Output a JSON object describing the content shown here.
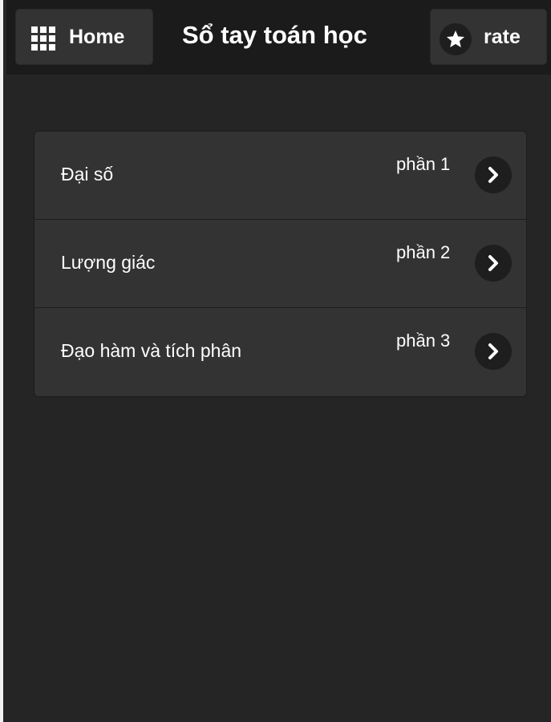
{
  "header": {
    "home_label": "Home",
    "title": "Sổ tay toán học",
    "rate_label": "rate",
    "home_icon": "grid-icon",
    "rate_icon": "star-icon"
  },
  "list": {
    "items": [
      {
        "label": "Đại số",
        "count": "phần 1",
        "icon": "chevron-right-icon"
      },
      {
        "label": "Lượng giác",
        "count": "phần 2",
        "icon": "chevron-right-icon"
      },
      {
        "label": "Đạo hàm và tích phân",
        "count": "phần 3",
        "icon": "chevron-right-icon"
      }
    ]
  },
  "colors": {
    "background": "#252525",
    "header_bg": "#1b1b1b",
    "button_bg": "#333333",
    "text": "#ffffff"
  }
}
